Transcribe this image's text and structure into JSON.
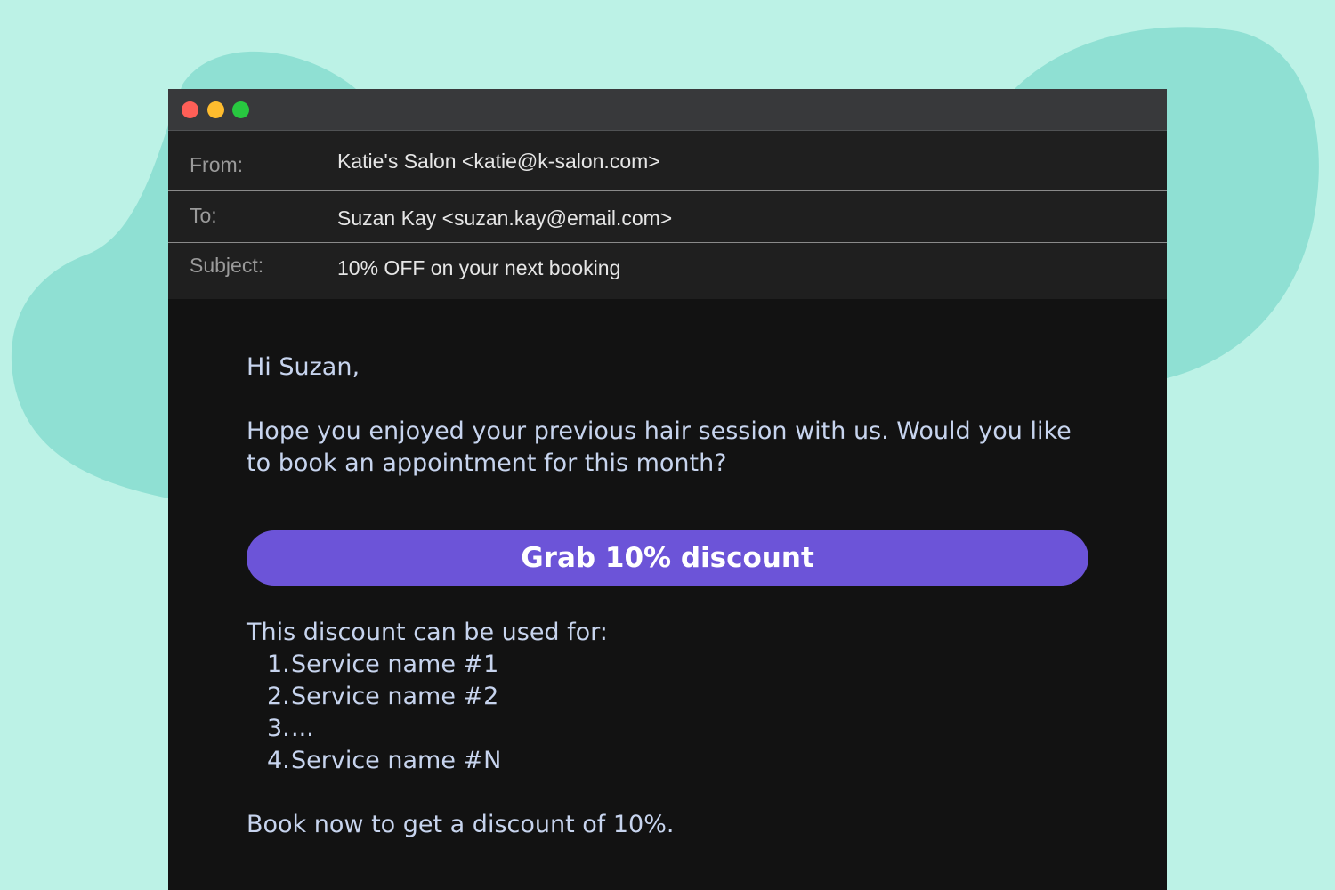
{
  "colors": {
    "background": "#bcf2e6",
    "blob": "#8fe0d3",
    "window_body": "#121212",
    "titlebar": "#38393b",
    "header_rows": "#1f1f1f",
    "button": "#6c54d8",
    "body_text": "#c7d4ee",
    "close_dot": "#fe5f57",
    "minimize_dot": "#febc2e",
    "zoom_dot": "#28c840"
  },
  "window": {
    "controls": [
      "close",
      "minimize",
      "zoom"
    ]
  },
  "email": {
    "from_label": "From:",
    "from_value": "Katie's Salon <katie@k-salon.com>",
    "to_label": "To:",
    "to_value": "Suzan Kay <suzan.kay@email.com>",
    "subject_label": "Subject:",
    "subject_value": "10% OFF on your next booking"
  },
  "body": {
    "greeting": "Hi Suzan,",
    "intro": "Hope you enjoyed your previous hair session with us. Would you like to book an appointment for this month?",
    "cta_label": "Grab 10% discount",
    "uses_heading": "This discount can be used for:",
    "services": [
      {
        "num": "1.",
        "name": "Service name #1"
      },
      {
        "num": "2.",
        "name": "Service name #2"
      },
      {
        "num": "3.",
        "name": "..."
      },
      {
        "num": "4.",
        "name": "Service name #N"
      }
    ],
    "closing": "Book now to get a discount of 10%."
  }
}
